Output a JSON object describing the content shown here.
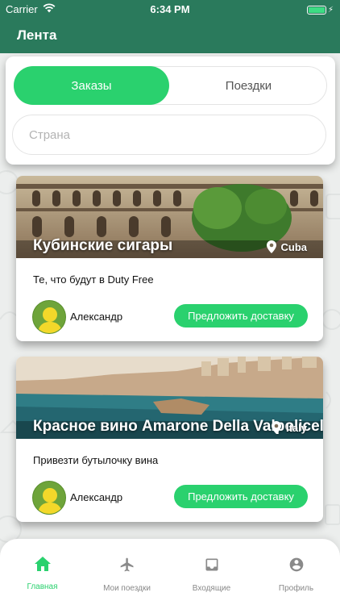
{
  "status": {
    "carrier": "Carrier",
    "time": "6:34 PM"
  },
  "header": {
    "title": "Лента"
  },
  "segment": {
    "orders": "Заказы",
    "trips": "Поездки"
  },
  "filter": {
    "country_placeholder": "Страна"
  },
  "posts": [
    {
      "title": "Кубинские сигары",
      "location": "Cuba",
      "description": "Те, что будут в Duty Free",
      "author": "Александр",
      "action": "Предложить доставку"
    },
    {
      "title": "Красное вино Amarone Della Valpolicella",
      "location": "Italy",
      "description": "Привезти бутылочку вина",
      "author": "Александр",
      "action": "Предложить доставку"
    }
  ],
  "tabs": [
    {
      "label": "Главная",
      "icon": "home-icon"
    },
    {
      "label": "Мои поездки",
      "icon": "airplane-icon"
    },
    {
      "label": "Входящие",
      "icon": "inbox-icon"
    },
    {
      "label": "Профиль",
      "icon": "account-icon"
    }
  ],
  "colors": {
    "header": "#2a7a5c",
    "accent": "#2ad16e"
  }
}
